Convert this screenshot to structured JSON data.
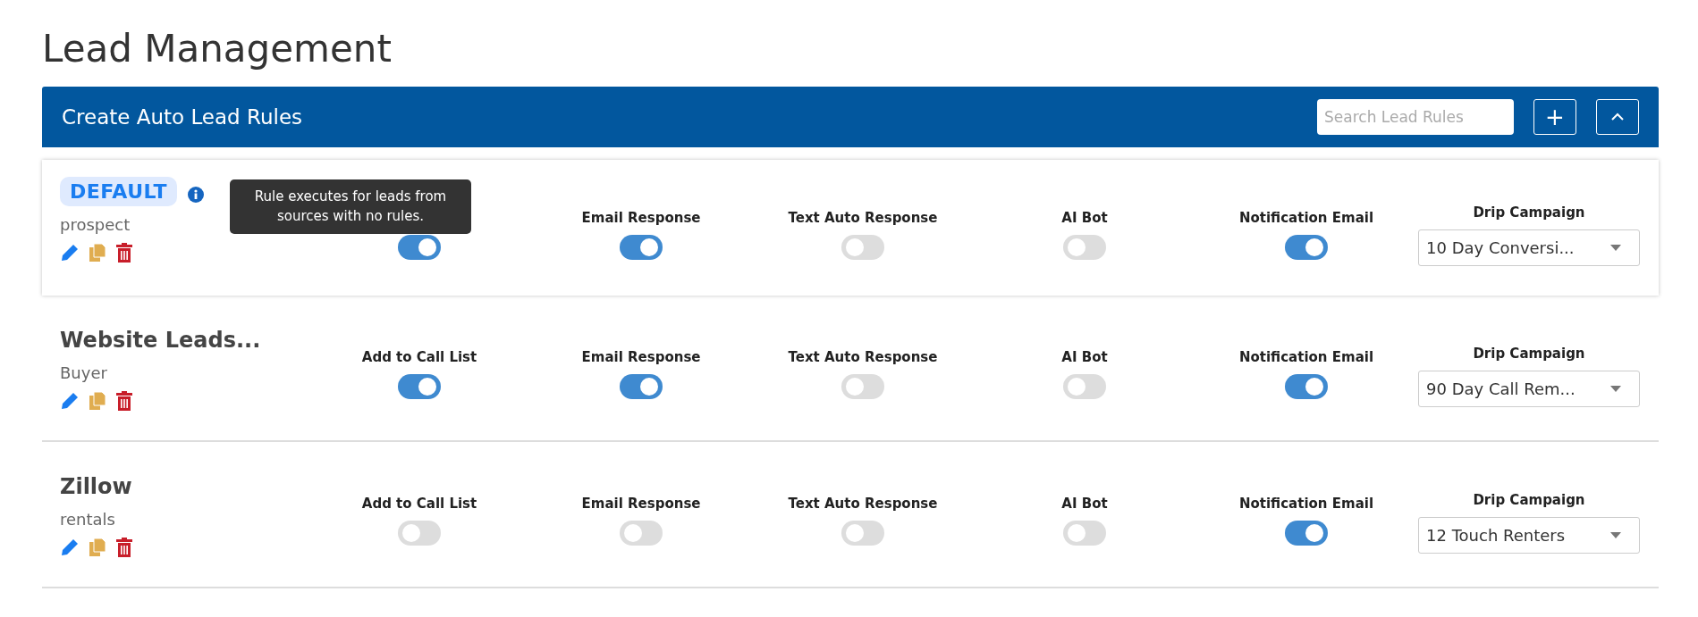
{
  "page_title": "Lead Management",
  "panel": {
    "title": "Create Auto Lead Rules",
    "search": {
      "placeholder": "Search Lead Rules"
    },
    "add_button": "+"
  },
  "rules": [
    {
      "name": "DEFAULT",
      "kind": "default",
      "subtitle": "prospect",
      "tooltip": "Rule executes for leads from sources with no rules.",
      "toggles": [
        {
          "on": true
        },
        {
          "label": "Email Response",
          "on": true
        },
        {
          "label": "Text Auto Response",
          "on": false
        },
        {
          "label": "AI Bot",
          "on": false
        },
        {
          "label": "Notification Email",
          "on": true
        }
      ],
      "drip": {
        "label": "Drip Campaign",
        "value": "10 Day Conversi..."
      }
    },
    {
      "name": "Website Leads...",
      "kind": "normal",
      "subtitle": "Buyer",
      "toggles": [
        {
          "label": "Add to Call List",
          "on": true
        },
        {
          "label": "Email Response",
          "on": true
        },
        {
          "label": "Text Auto Response",
          "on": false
        },
        {
          "label": "AI Bot",
          "on": false
        },
        {
          "label": "Notification Email",
          "on": true
        }
      ],
      "drip": {
        "label": "Drip Campaign",
        "value": "90 Day Call Rem..."
      }
    },
    {
      "name": "Zillow",
      "kind": "normal",
      "subtitle": "rentals",
      "toggles": [
        {
          "label": "Add to Call List",
          "on": false
        },
        {
          "label": "Email Response",
          "on": false
        },
        {
          "label": "Text Auto Response",
          "on": false
        },
        {
          "label": "AI Bot",
          "on": false
        },
        {
          "label": "Notification Email",
          "on": true
        }
      ],
      "drip": {
        "label": "Drip Campaign",
        "value": "12 Touch Renters"
      }
    }
  ]
}
